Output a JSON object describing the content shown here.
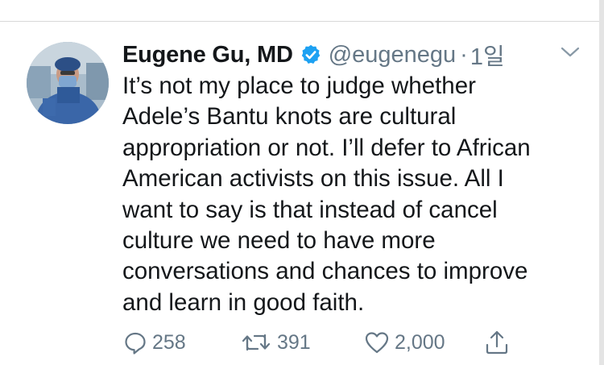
{
  "tweet": {
    "author_name": "Eugene Gu, MD",
    "handle": "@eugenegu",
    "separator": "·",
    "timestamp": "1일",
    "verified": true,
    "text_lines": [
      "It’s not my place to judge whether",
      "Adele’s Bantu knots are cultural",
      "appropriation or not. I’ll defer to African",
      "American activists on this issue. All I",
      "want to say is that instead of cancel",
      "culture we need to have more",
      "conversations and chances to improve",
      "and learn in good faith."
    ]
  },
  "actions": {
    "reply_count": "258",
    "retweet_count": "391",
    "like_count": "2,000"
  },
  "icons": {
    "more": "chevron-down-icon",
    "verified": "verified-badge-icon",
    "reply": "reply-icon",
    "retweet": "retweet-icon",
    "like": "heart-icon",
    "share": "share-icon"
  },
  "colors": {
    "text": "#14171a",
    "secondary": "#657786",
    "verified_blue": "#1da1f2"
  }
}
